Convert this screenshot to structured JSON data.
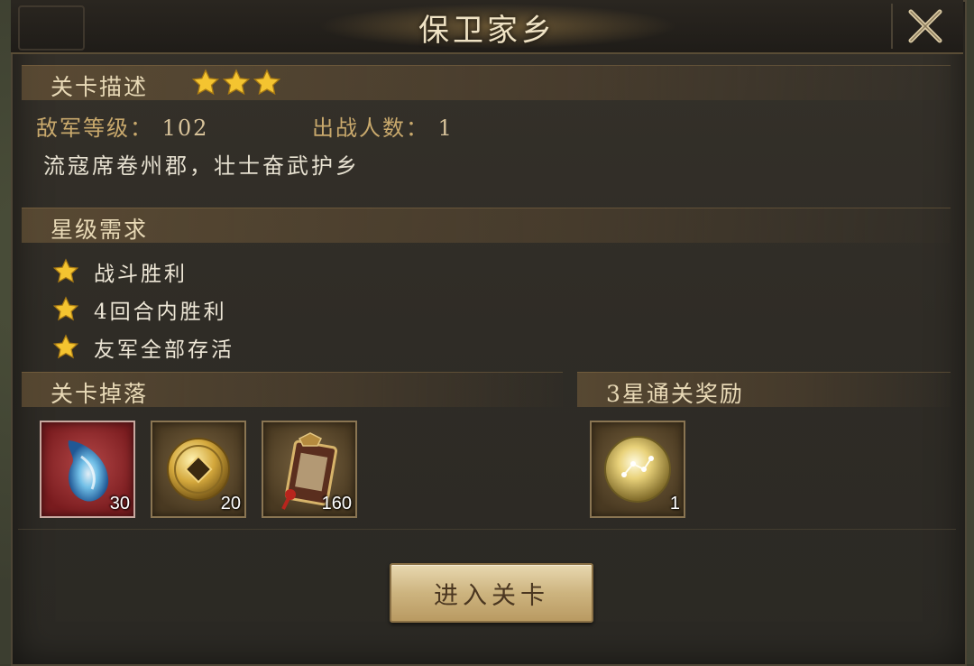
{
  "window": {
    "title": "保卫家乡"
  },
  "stage_description": {
    "section_label": "关卡描述",
    "stars": 3,
    "enemy_level_label": "敌军等级：",
    "enemy_level_value": "102",
    "troop_count_label": "出战人数：",
    "troop_count_value": "1",
    "description": "流寇席卷州郡，壮士奋武护乡"
  },
  "star_requirements": {
    "section_label": "星级需求",
    "items": [
      {
        "label": "战斗胜利"
      },
      {
        "label": "4回合内胜利"
      },
      {
        "label": "友军全部存活"
      }
    ]
  },
  "stage_drops": {
    "section_label": "关卡掉落",
    "items": [
      {
        "icon": "blue-flame-crystal-icon",
        "count": "30"
      },
      {
        "icon": "gold-coin-icon",
        "count": "20"
      },
      {
        "icon": "scroll-token-icon",
        "count": "160"
      }
    ]
  },
  "three_star_reward": {
    "section_label": "3星通关奖励",
    "items": [
      {
        "icon": "golden-orb-icon",
        "count": "1"
      }
    ]
  },
  "actions": {
    "enter_label": "进入关卡"
  },
  "colors": {
    "panel": "#2f2c26",
    "accent_gold": "#c9a96c",
    "button": "#cdb47f",
    "star": "#f4c430"
  }
}
